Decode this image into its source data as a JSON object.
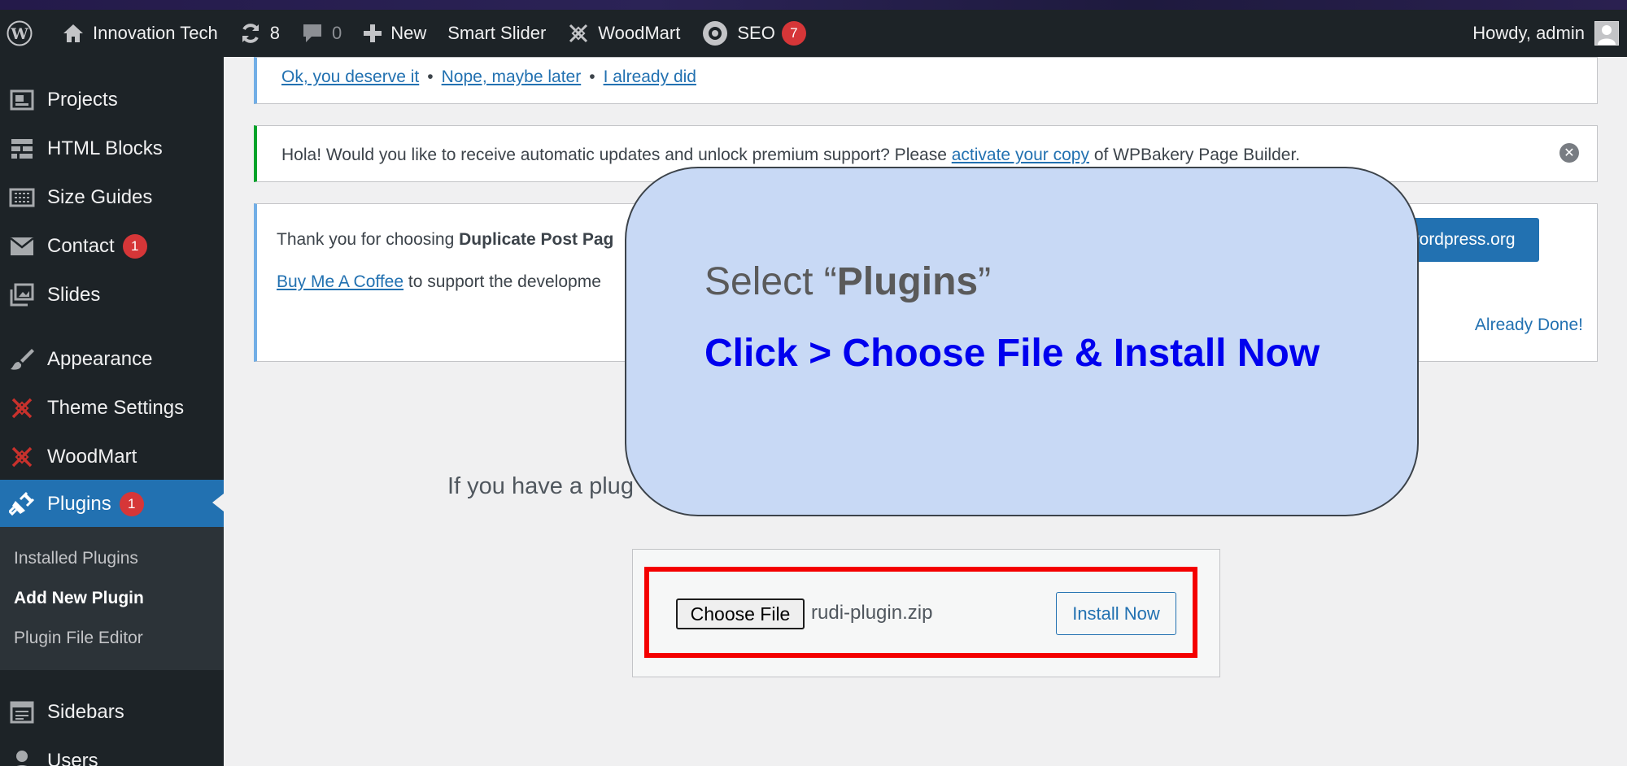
{
  "adminbar": {
    "site_name": "Innovation Tech",
    "updates_count": "8",
    "comments_count": "0",
    "new_label": "New",
    "smart_slider_label": "Smart Slider",
    "woodmart_label": "WoodMart",
    "seo_label": "SEO",
    "seo_badge": "7",
    "howdy": "Howdy, admin"
  },
  "sidebar": {
    "items": [
      {
        "label": "Projects",
        "icon": "portfolio-icon"
      },
      {
        "label": "HTML Blocks",
        "icon": "grid-icon"
      },
      {
        "label": "Size Guides",
        "icon": "ruler-icon"
      },
      {
        "label": "Contact",
        "icon": "envelope-icon",
        "badge": "1"
      },
      {
        "label": "Slides",
        "icon": "slides-icon"
      },
      {
        "label": "Appearance",
        "icon": "paintbrush-icon"
      },
      {
        "label": "Theme Settings",
        "icon": "woodmart-logo-icon"
      },
      {
        "label": "WoodMart",
        "icon": "woodmart-logo-icon"
      },
      {
        "label": "Plugins",
        "icon": "plugin-icon",
        "badge": "1"
      },
      {
        "label": "Sidebars",
        "icon": "sidebar-icon"
      },
      {
        "label": "Users",
        "icon": "user-icon"
      }
    ],
    "submenu": [
      "Installed Plugins",
      "Add New Plugin",
      "Plugin File Editor"
    ]
  },
  "notices": {
    "review_links": [
      "Ok, you deserve it",
      "Nope, maybe later",
      "I already did"
    ],
    "wpbakery_pre": "Hola! Would you like to receive automatic updates and unlock premium support? Please ",
    "wpbakery_link": "activate your copy",
    "wpbakery_post": " of WPBakery Page Builder.",
    "dup_pre": "Thank you for choosing ",
    "dup_bold": "Duplicate Post Pag",
    "coffee_link": "Buy Me A Coffee",
    "coffee_post": " to support the developme",
    "wp_button": "wordpress.org",
    "already_done": "Already Done!"
  },
  "main": {
    "intro": "If you have a plug",
    "choose_file": "Choose File",
    "file_name": "rudi-plugin.zip",
    "install_now": "Install Now"
  },
  "callout": {
    "select_pre": "Select “",
    "select_bold": "Plugins",
    "select_post": "”",
    "instruction": "Click > Choose File & Install Now"
  },
  "colors": {
    "accent": "#2271b1",
    "badge": "#d63638",
    "highlight_frame": "#f40000",
    "callout_bg": "#c8d9f5"
  }
}
